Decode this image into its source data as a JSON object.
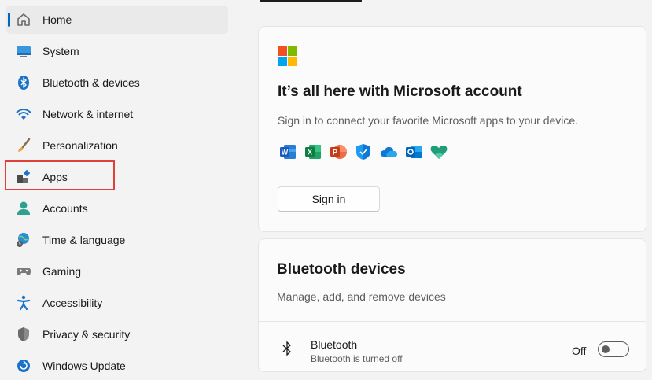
{
  "sidebar": {
    "items": [
      {
        "label": "Home",
        "icon": "home-icon"
      },
      {
        "label": "System",
        "icon": "system-icon"
      },
      {
        "label": "Bluetooth & devices",
        "icon": "bluetooth-icon"
      },
      {
        "label": "Network & internet",
        "icon": "wifi-icon"
      },
      {
        "label": "Personalization",
        "icon": "brush-icon"
      },
      {
        "label": "Apps",
        "icon": "apps-icon"
      },
      {
        "label": "Accounts",
        "icon": "account-icon"
      },
      {
        "label": "Time & language",
        "icon": "globe-clock-icon"
      },
      {
        "label": "Gaming",
        "icon": "gamepad-icon"
      },
      {
        "label": "Accessibility",
        "icon": "accessibility-icon"
      },
      {
        "label": "Privacy & security",
        "icon": "shield-icon"
      },
      {
        "label": "Windows Update",
        "icon": "update-icon"
      }
    ],
    "active": "Home",
    "highlighted": "Apps"
  },
  "microsoft_card": {
    "title": "It’s all here with Microsoft account",
    "subtitle": "Sign in to connect your favorite Microsoft apps to your device.",
    "apps": [
      "Word",
      "Excel",
      "PowerPoint",
      "Defender",
      "OneDrive",
      "Outlook",
      "Family Safety"
    ],
    "sign_in_label": "Sign in"
  },
  "bluetooth_card": {
    "title": "Bluetooth devices",
    "subtitle": "Manage, add, and remove devices",
    "row": {
      "title": "Bluetooth",
      "subtitle": "Bluetooth is turned off",
      "toggle_label": "Off",
      "toggle_on": false
    }
  },
  "colors": {
    "accent": "#0067c0",
    "highlight_box": "#e0403a"
  }
}
